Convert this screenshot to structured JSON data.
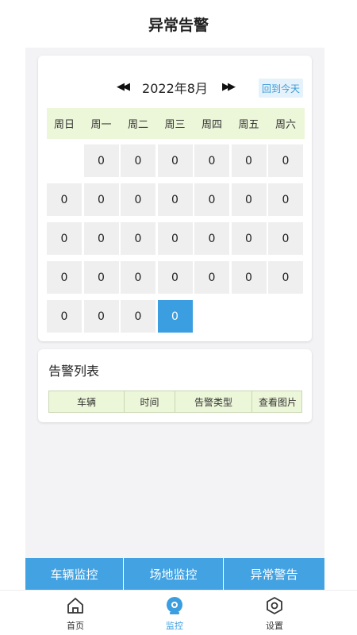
{
  "header": {
    "title": "异常告警"
  },
  "calendar": {
    "month_label": "2022年8月",
    "prev_icon": "double-left-arrow",
    "next_icon": "double-right-arrow",
    "today_button": "回到今天",
    "weekdays": [
      "周日",
      "周一",
      "周二",
      "周三",
      "周四",
      "周五",
      "周六"
    ],
    "days": [
      "",
      "0",
      "0",
      "0",
      "0",
      "0",
      "0",
      "0",
      "0",
      "0",
      "0",
      "0",
      "0",
      "0",
      "0",
      "0",
      "0",
      "0",
      "0",
      "0",
      "0",
      "0",
      "0",
      "0",
      "0",
      "0",
      "0",
      "0",
      "0",
      "0",
      "0",
      "0"
    ],
    "selected_index": 31
  },
  "alarm_list": {
    "title": "告警列表",
    "columns": [
      "车辆",
      "时间",
      "告警类型",
      "查看图片"
    ]
  },
  "tabs": [
    {
      "label": "车辆监控"
    },
    {
      "label": "场地监控"
    },
    {
      "label": "异常警告"
    }
  ],
  "bottom_nav": {
    "home": {
      "label": "首页",
      "icon": "home-icon"
    },
    "monitor": {
      "label": "监控",
      "icon": "camera-icon",
      "active": true
    },
    "settings": {
      "label": "设置",
      "icon": "hexagon-gear-icon"
    }
  },
  "colors": {
    "accent": "#42a2e2",
    "header_green": "#ecf6d9",
    "cell_gray": "#efefef"
  }
}
